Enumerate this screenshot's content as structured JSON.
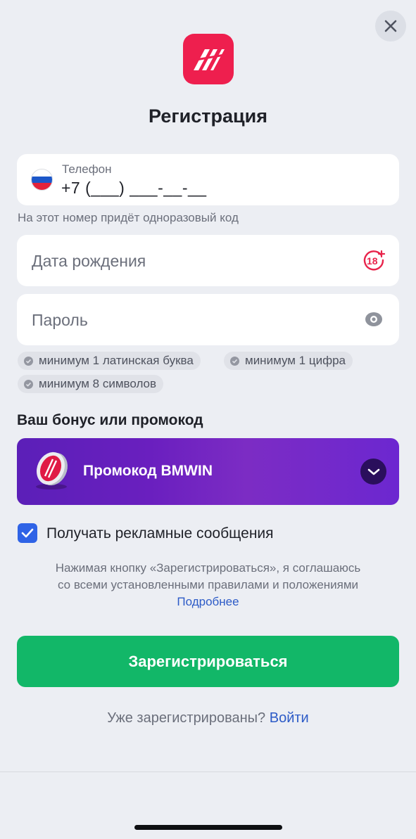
{
  "header": {
    "close_icon": "close-icon",
    "logo_icon": "bookmaker-logo-icon",
    "title": "Регистрация"
  },
  "phone": {
    "label": "Телефон",
    "value": "+7 (___) ___-__-__",
    "country_flag": "russia-flag-icon",
    "hint": "На этот номер придёт одноразовый код"
  },
  "birth_date": {
    "placeholder": "Дата рождения",
    "icon": "age-18-plus-icon"
  },
  "password": {
    "placeholder": "Пароль",
    "icon": "eye-icon",
    "requirements": [
      "минимум 1 латинская буква",
      "минимум 1 цифра",
      "минимум 8 символов"
    ]
  },
  "bonus": {
    "section_title": "Ваш бонус или промокод",
    "promo_label": "Промокод BMWIN",
    "badge_icon": "promo-coin-icon",
    "chevron_icon": "chevron-down-icon"
  },
  "marketing": {
    "checked": true,
    "label": "Получать рекламные сообщения"
  },
  "terms": {
    "line1": "Нажимая кнопку «Зарегистрироваться», я соглашаюсь",
    "line2": "со всеми установленными правилами и положениями",
    "link": "Подробнее"
  },
  "submit_label": "Зарегистрироваться",
  "login": {
    "question": "Уже зарегистрированы?",
    "link": "Войти"
  },
  "colors": {
    "background": "#eceef3",
    "brand_red": "#ee1f4e",
    "promo_purple": "#6a1fbf",
    "submit_green": "#12b768",
    "link_blue": "#2d5bc7",
    "checkbox_blue": "#2f63e6"
  }
}
